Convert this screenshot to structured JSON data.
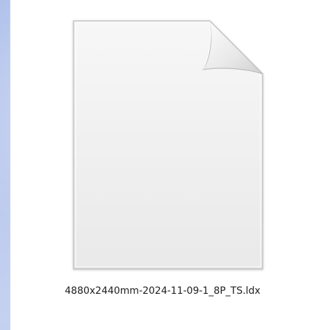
{
  "file": {
    "name": "4880x2440mm-2024-11-09-1_8P_TS.ldx",
    "icon": "generic-document-icon"
  },
  "colors": {
    "desktop": "#b9c7ec",
    "pane": "#ffffff",
    "label": "#1c1c1c"
  }
}
